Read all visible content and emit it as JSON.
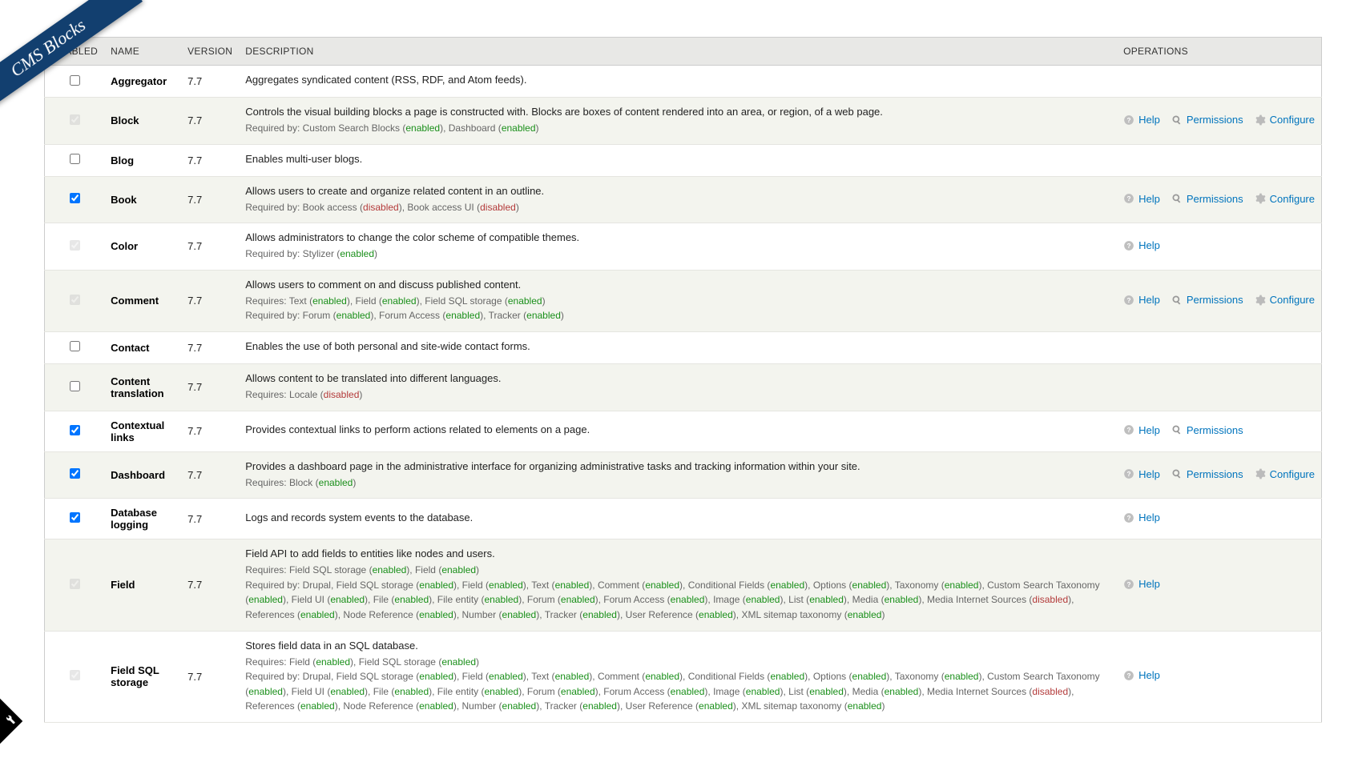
{
  "banner": "CMS Blocks",
  "headers": {
    "enabled": "ENABLED",
    "name": "NAME",
    "version": "VERSION",
    "description": "DESCRIPTION",
    "operations": "OPERATIONS"
  },
  "op_labels": {
    "help": "Help",
    "permissions": "Permissions",
    "configure": "Configure"
  },
  "status": {
    "enabled": "enabled",
    "disabled": "disabled"
  },
  "modules": [
    {
      "name": "Aggregator",
      "version": "7.7",
      "checked": false,
      "locked": false,
      "desc": "Aggregates syndicated content (RSS, RDF, and Atom feeds).",
      "deps": [],
      "ops": []
    },
    {
      "name": "Block",
      "version": "7.7",
      "checked": true,
      "locked": true,
      "desc": "Controls the visual building blocks a page is constructed with. Blocks are boxes of content rendered into an area, or region, of a web page.",
      "deps": [
        {
          "label": "Required by:",
          "items": [
            {
              "t": "Custom Search Blocks",
              "s": "en"
            },
            {
              "t": "Dashboard",
              "s": "en"
            }
          ]
        }
      ],
      "ops": [
        "help",
        "permissions",
        "configure"
      ]
    },
    {
      "name": "Blog",
      "version": "7.7",
      "checked": false,
      "locked": false,
      "desc": "Enables multi-user blogs.",
      "deps": [],
      "ops": []
    },
    {
      "name": "Book",
      "version": "7.7",
      "checked": true,
      "locked": false,
      "desc": "Allows users to create and organize related content in an outline.",
      "deps": [
        {
          "label": "Required by:",
          "items": [
            {
              "t": "Book access",
              "s": "dis"
            },
            {
              "t": "Book access UI",
              "s": "dis"
            }
          ]
        }
      ],
      "ops": [
        "help",
        "permissions",
        "configure"
      ]
    },
    {
      "name": "Color",
      "version": "7.7",
      "checked": true,
      "locked": true,
      "desc": "Allows administrators to change the color scheme of compatible themes.",
      "deps": [
        {
          "label": "Required by:",
          "items": [
            {
              "t": "Stylizer",
              "s": "en"
            }
          ]
        }
      ],
      "ops": [
        "help"
      ]
    },
    {
      "name": "Comment",
      "version": "7.7",
      "checked": true,
      "locked": true,
      "desc": "Allows users to comment on and discuss published content.",
      "deps": [
        {
          "label": "Requires:",
          "items": [
            {
              "t": "Text",
              "s": "en"
            },
            {
              "t": "Field",
              "s": "en"
            },
            {
              "t": "Field SQL storage",
              "s": "en"
            }
          ]
        },
        {
          "label": "Required by:",
          "items": [
            {
              "t": "Forum",
              "s": "en"
            },
            {
              "t": "Forum Access",
              "s": "en"
            },
            {
              "t": "Tracker",
              "s": "en"
            }
          ]
        }
      ],
      "ops": [
        "help",
        "permissions",
        "configure"
      ]
    },
    {
      "name": "Contact",
      "version": "7.7",
      "checked": false,
      "locked": false,
      "desc": "Enables the use of both personal and site-wide contact forms.",
      "deps": [],
      "ops": []
    },
    {
      "name": "Content translation",
      "version": "7.7",
      "checked": false,
      "locked": false,
      "desc": "Allows content to be translated into different languages.",
      "deps": [
        {
          "label": "Requires:",
          "items": [
            {
              "t": "Locale",
              "s": "dis"
            }
          ]
        }
      ],
      "ops": []
    },
    {
      "name": "Contextual links",
      "version": "7.7",
      "checked": true,
      "locked": false,
      "desc": "Provides contextual links to perform actions related to elements on a page.",
      "deps": [],
      "ops": [
        "help",
        "permissions"
      ]
    },
    {
      "name": "Dashboard",
      "version": "7.7",
      "checked": true,
      "locked": false,
      "desc": "Provides a dashboard page in the administrative interface for organizing administrative tasks and tracking information within your site.",
      "deps": [
        {
          "label": "Requires:",
          "items": [
            {
              "t": "Block",
              "s": "en"
            }
          ]
        }
      ],
      "ops": [
        "help",
        "permissions",
        "configure"
      ]
    },
    {
      "name": "Database logging",
      "version": "7.7",
      "checked": true,
      "locked": false,
      "desc": "Logs and records system events to the database.",
      "deps": [],
      "ops": [
        "help"
      ]
    },
    {
      "name": "Field",
      "version": "7.7",
      "checked": true,
      "locked": true,
      "desc": "Field API to add fields to entities like nodes and users.",
      "deps": [
        {
          "label": "Requires:",
          "items": [
            {
              "t": "Field SQL storage",
              "s": "en"
            },
            {
              "t": "Field",
              "s": "en"
            }
          ]
        },
        {
          "label": "Required by:",
          "items": [
            {
              "t": "Drupal"
            },
            {
              "t": "Field SQL storage",
              "s": "en"
            },
            {
              "t": "Field",
              "s": "en"
            },
            {
              "t": "Text",
              "s": "en"
            },
            {
              "t": "Comment",
              "s": "en"
            },
            {
              "t": "Conditional Fields",
              "s": "en"
            },
            {
              "t": "Options",
              "s": "en"
            },
            {
              "t": "Taxonomy",
              "s": "en"
            },
            {
              "t": "Custom Search Taxonomy",
              "s": "en"
            },
            {
              "t": "Field UI",
              "s": "en"
            },
            {
              "t": "File",
              "s": "en"
            },
            {
              "t": "File entity",
              "s": "en"
            },
            {
              "t": "Forum",
              "s": "en"
            },
            {
              "t": "Forum Access",
              "s": "en"
            },
            {
              "t": "Image",
              "s": "en"
            },
            {
              "t": "List",
              "s": "en"
            },
            {
              "t": "Media",
              "s": "en"
            },
            {
              "t": "Media Internet Sources",
              "s": "dis"
            },
            {
              "t": "References",
              "s": "en"
            },
            {
              "t": "Node Reference",
              "s": "en"
            },
            {
              "t": "Number",
              "s": "en"
            },
            {
              "t": "Tracker",
              "s": "en"
            },
            {
              "t": "User Reference",
              "s": "en"
            },
            {
              "t": "XML sitemap taxonomy",
              "s": "en"
            }
          ]
        }
      ],
      "ops": [
        "help"
      ]
    },
    {
      "name": "Field SQL storage",
      "version": "7.7",
      "checked": true,
      "locked": true,
      "desc": "Stores field data in an SQL database.",
      "deps": [
        {
          "label": "Requires:",
          "items": [
            {
              "t": "Field",
              "s": "en"
            },
            {
              "t": "Field SQL storage",
              "s": "en"
            }
          ]
        },
        {
          "label": "Required by:",
          "items": [
            {
              "t": "Drupal"
            },
            {
              "t": "Field SQL storage",
              "s": "en"
            },
            {
              "t": "Field",
              "s": "en"
            },
            {
              "t": "Text",
              "s": "en"
            },
            {
              "t": "Comment",
              "s": "en"
            },
            {
              "t": "Conditional Fields",
              "s": "en"
            },
            {
              "t": "Options",
              "s": "en"
            },
            {
              "t": "Taxonomy",
              "s": "en"
            },
            {
              "t": "Custom Search Taxonomy",
              "s": "en"
            },
            {
              "t": "Field UI",
              "s": "en"
            },
            {
              "t": "File",
              "s": "en"
            },
            {
              "t": "File entity",
              "s": "en"
            },
            {
              "t": "Forum",
              "s": "en"
            },
            {
              "t": "Forum Access",
              "s": "en"
            },
            {
              "t": "Image",
              "s": "en"
            },
            {
              "t": "List",
              "s": "en"
            },
            {
              "t": "Media",
              "s": "en"
            },
            {
              "t": "Media Internet Sources",
              "s": "dis"
            },
            {
              "t": "References",
              "s": "en"
            },
            {
              "t": "Node Reference",
              "s": "en"
            },
            {
              "t": "Number",
              "s": "en"
            },
            {
              "t": "Tracker",
              "s": "en"
            },
            {
              "t": "User Reference",
              "s": "en"
            },
            {
              "t": "XML sitemap taxonomy",
              "s": "en"
            }
          ]
        }
      ],
      "ops": [
        "help"
      ]
    }
  ]
}
